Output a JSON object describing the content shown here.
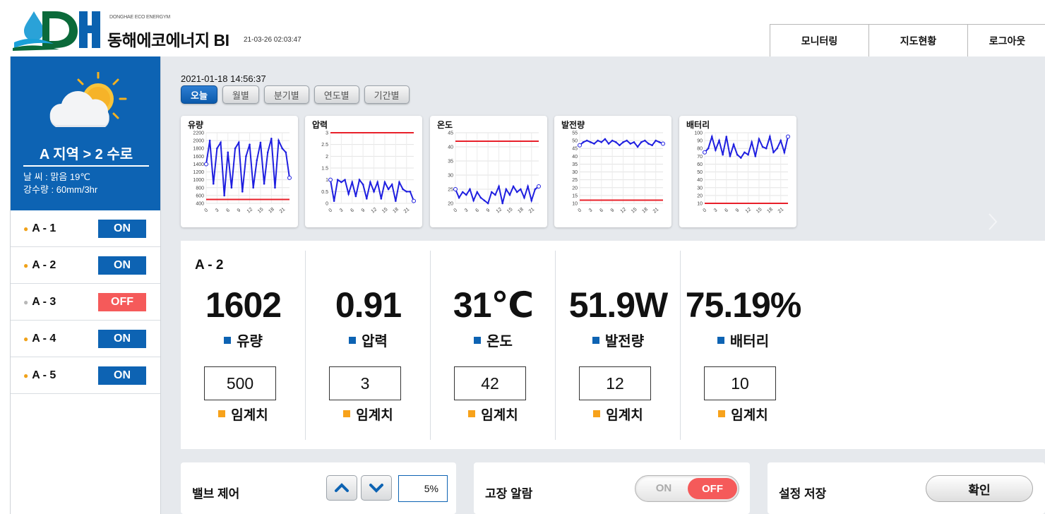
{
  "header": {
    "brand_small": "DONGHAE ECO ENERGYM",
    "title": "동해에코에너지 BI",
    "timestamp": "21-03-26 02:03:47",
    "nav": [
      "모니터링",
      "지도현황",
      "로그아웃"
    ]
  },
  "sidebar": {
    "region": "A 지역 > 2 수로",
    "weather": "날   씨 : 맑음 19℃",
    "rain": "강수량 : 60mm/3hr",
    "items": [
      {
        "name": "A - 1",
        "status": "ON"
      },
      {
        "name": "A - 2",
        "status": "ON"
      },
      {
        "name": "A - 3",
        "status": "OFF"
      },
      {
        "name": "A - 4",
        "status": "ON"
      },
      {
        "name": "A - 5",
        "status": "ON"
      }
    ]
  },
  "main": {
    "datetime": "2021-01-18 14:56:37",
    "tabs": [
      "오늘",
      "월별",
      "분기별",
      "연도별",
      "기간별"
    ],
    "active_tab": "오늘"
  },
  "chart_data": [
    {
      "type": "line",
      "title": "유량",
      "x": [
        0,
        1,
        2,
        3,
        4,
        5,
        6,
        7,
        8,
        9,
        10,
        11,
        12,
        13,
        14,
        15,
        16,
        17,
        18,
        19,
        20,
        21,
        22,
        23
      ],
      "ylim": [
        400,
        2200
      ],
      "yticks": [
        400,
        600,
        800,
        1000,
        1200,
        1400,
        1600,
        1800,
        2000,
        2200
      ],
      "xticks": [
        0,
        3,
        6,
        9,
        12,
        15,
        18,
        21
      ],
      "series": [
        {
          "values": [
            1400,
            2000,
            900,
            1800,
            1950,
            600,
            1700,
            800,
            1800,
            1950,
            700,
            1600,
            1900,
            800,
            1500,
            1950,
            900,
            1700,
            2050,
            800,
            2000,
            1800,
            1700,
            1050
          ]
        }
      ],
      "threshold": 500
    },
    {
      "type": "line",
      "title": "압력",
      "x": [
        0,
        1,
        2,
        3,
        4,
        5,
        6,
        7,
        8,
        9,
        10,
        11,
        12,
        13,
        14,
        15,
        16,
        17,
        18,
        19,
        20,
        21,
        22,
        23
      ],
      "ylim": [
        0,
        3.0
      ],
      "yticks": [
        0,
        0.5,
        1.0,
        1.5,
        2.0,
        2.5,
        3.0
      ],
      "xticks": [
        0,
        3,
        6,
        9,
        12,
        15,
        18,
        21
      ],
      "series": [
        {
          "values": [
            1.0,
            0.1,
            1.0,
            0.9,
            1.0,
            0.4,
            0.9,
            0.3,
            1.0,
            0.8,
            0.2,
            0.9,
            0.5,
            0.9,
            0.2,
            0.9,
            0.6,
            0.8,
            0.1,
            0.9,
            0.6,
            0.5,
            0.5,
            0.1
          ]
        }
      ],
      "threshold": 3.0
    },
    {
      "type": "line",
      "title": "온도",
      "x": [
        0,
        1,
        2,
        3,
        4,
        5,
        6,
        7,
        8,
        9,
        10,
        11,
        12,
        13,
        14,
        15,
        16,
        17,
        18,
        19,
        20,
        21,
        22,
        23
      ],
      "ylim": [
        20,
        45
      ],
      "yticks": [
        20,
        25,
        30,
        35,
        40,
        45
      ],
      "xticks": [
        0,
        3,
        6,
        9,
        12,
        15,
        18,
        21
      ],
      "series": [
        {
          "values": [
            25,
            22,
            24,
            23,
            25,
            21,
            24,
            22,
            21,
            20,
            24,
            23,
            26,
            20,
            25,
            23,
            26,
            24,
            25,
            22,
            26,
            21,
            25,
            26
          ]
        }
      ],
      "threshold": 42
    },
    {
      "type": "line",
      "title": "발전량",
      "x": [
        0,
        1,
        2,
        3,
        4,
        5,
        6,
        7,
        8,
        9,
        10,
        11,
        12,
        13,
        14,
        15,
        16,
        17,
        18,
        19,
        20,
        21,
        22,
        23
      ],
      "ylim": [
        10,
        55
      ],
      "yticks": [
        10,
        15,
        20,
        25,
        30,
        35,
        40,
        45,
        50,
        55
      ],
      "xticks": [
        0,
        3,
        6,
        9,
        12,
        15,
        18,
        21
      ],
      "series": [
        {
          "values": [
            47,
            49,
            50,
            49,
            48,
            50,
            49,
            51,
            48,
            50,
            49,
            47,
            49,
            50,
            48,
            49,
            46,
            49,
            50,
            48,
            47,
            50,
            49,
            48
          ]
        }
      ],
      "threshold": 12
    },
    {
      "type": "line",
      "title": "배터리",
      "x": [
        0,
        1,
        2,
        3,
        4,
        5,
        6,
        7,
        8,
        9,
        10,
        11,
        12,
        13,
        14,
        15,
        16,
        17,
        18,
        19,
        20,
        21,
        22,
        23
      ],
      "ylim": [
        10,
        100
      ],
      "yticks": [
        10,
        20,
        30,
        40,
        50,
        60,
        70,
        80,
        90,
        100
      ],
      "xticks": [
        0,
        3,
        6,
        9,
        12,
        15,
        18,
        21
      ],
      "series": [
        {
          "values": [
            75,
            80,
            95,
            78,
            90,
            72,
            95,
            70,
            85,
            72,
            68,
            75,
            72,
            88,
            70,
            92,
            82,
            80,
            95,
            75,
            80,
            90,
            75,
            95
          ]
        }
      ],
      "threshold": 10
    }
  ],
  "detail": {
    "title": "A - 2",
    "metrics": [
      {
        "value": "1602",
        "label": "유량",
        "threshold": "500",
        "threshold_label": "임계치"
      },
      {
        "value": "0.91",
        "label": "압력",
        "threshold": "3",
        "threshold_label": "임계치"
      },
      {
        "value": "31℃",
        "label": "온도",
        "threshold": "42",
        "threshold_label": "임계치"
      },
      {
        "value": "51.9W",
        "label": "발전량",
        "threshold": "12",
        "threshold_label": "임계치"
      },
      {
        "value": "75.19%",
        "label": "배터리",
        "threshold": "10",
        "threshold_label": "임계치"
      }
    ]
  },
  "controls": {
    "valve_label": "밸브 제어",
    "valve_value": "5%",
    "alarm_label": "고장 알람",
    "alarm_on": "ON",
    "alarm_off": "OFF",
    "save_label": "설정 저장",
    "confirm": "확인"
  },
  "colors": {
    "primary": "#0d63b3",
    "off": "#f55a5a",
    "dot_on": "#f0a21a",
    "dot_off": "#b8b8b8",
    "line": "#1f1fe0",
    "threshold": "#e8202a"
  }
}
